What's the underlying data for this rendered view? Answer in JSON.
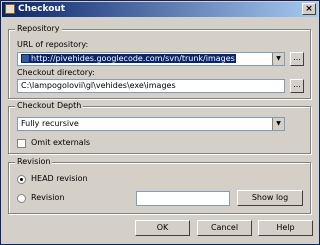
{
  "window": {
    "title": "Checkout",
    "close_glyph": "×"
  },
  "repository": {
    "group_title": "Repository",
    "url_label": "URL of repository:",
    "url_value": "http://pivehides.googlecode.com/svn/trunk/images",
    "dir_label": "Checkout directory:",
    "dir_value": "C:\\lampogolovii\\gl\\vehides\\exe\\images",
    "browse_label": "..."
  },
  "depth": {
    "group_title": "Checkout Depth",
    "selected": "Fully recursive",
    "omit_label": "Omit externals",
    "omit_checked": false
  },
  "revision": {
    "group_title": "Revision",
    "head_label": "HEAD revision",
    "head_selected": true,
    "revision_label": "Revision",
    "revision_value": "",
    "show_log_label": "Show log"
  },
  "footer": {
    "ok_label": "OK",
    "cancel_label": "Cancel",
    "help_label": "Help"
  }
}
